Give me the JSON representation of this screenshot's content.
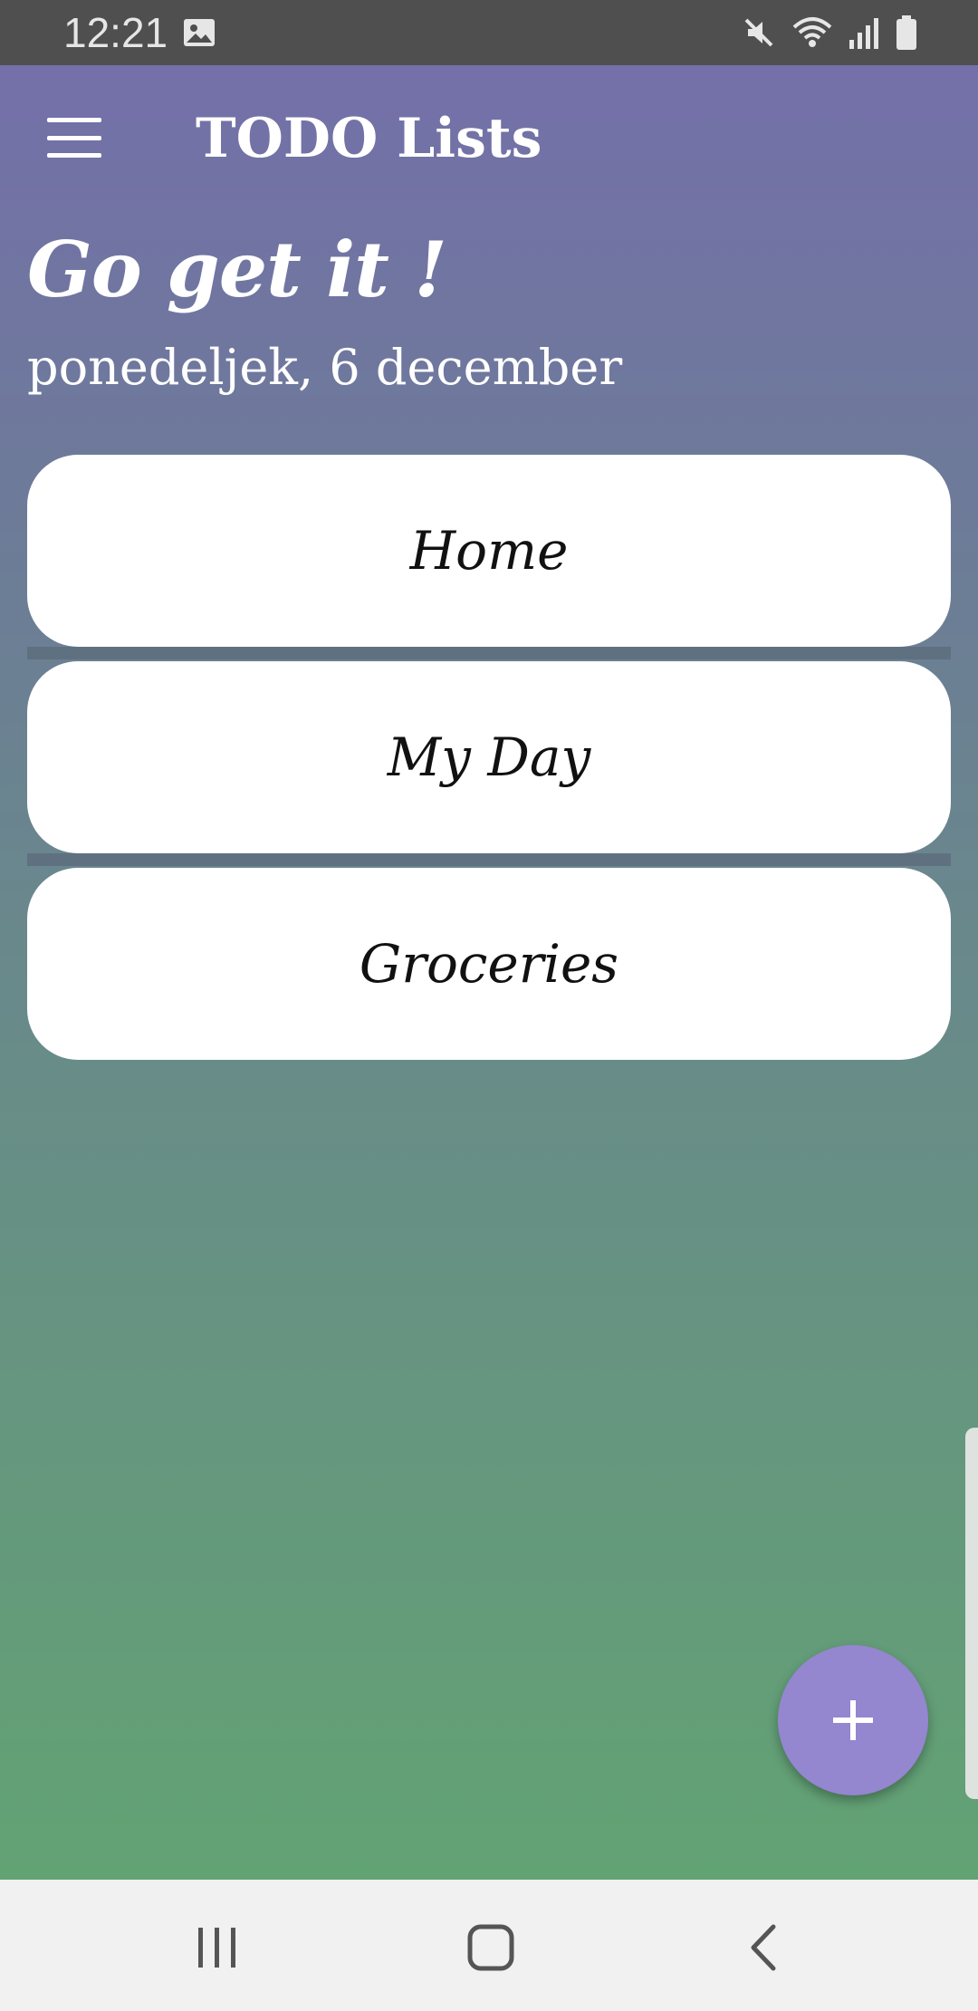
{
  "status_bar": {
    "time": "12:21",
    "icons": [
      "gallery-icon",
      "mute-icon",
      "wifi-icon",
      "signal-icon",
      "battery-icon"
    ]
  },
  "app_bar": {
    "title": "TODO Lists",
    "menu_icon": "menu-icon"
  },
  "header": {
    "greeting": "Go get it !",
    "date": "ponedeljek, 6 december"
  },
  "lists": [
    {
      "label": "Home"
    },
    {
      "label": "My Day"
    },
    {
      "label": "Groceries"
    }
  ],
  "fab": {
    "icon": "plus-icon"
  },
  "nav_bar": {
    "icons": [
      "recents-icon",
      "home-icon",
      "back-icon"
    ]
  },
  "colors": {
    "accent": "#9486cf",
    "gradient_top": "#7470a9",
    "gradient_bottom": "#62a373",
    "status_bar": "#4f4f4f"
  }
}
